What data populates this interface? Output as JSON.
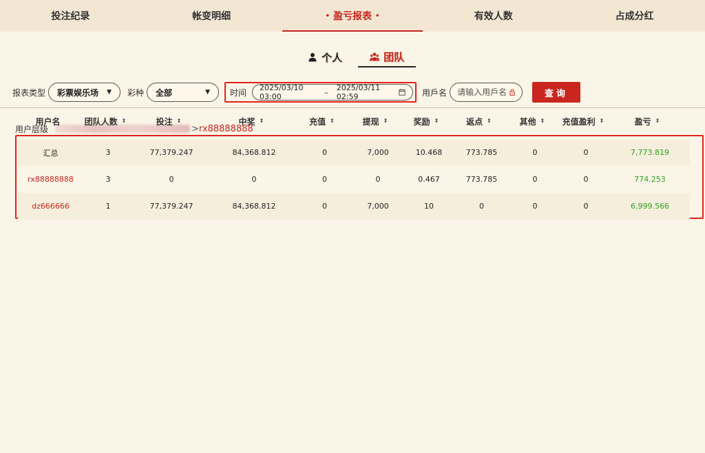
{
  "top_tabs": [
    {
      "label": "投注纪录",
      "active": false
    },
    {
      "label": "帐变明细",
      "active": false
    },
    {
      "label": "盈亏报表",
      "active": true
    },
    {
      "label": "有效人数",
      "active": false
    },
    {
      "label": "占成分红",
      "active": false
    }
  ],
  "active_tab_dots": "•",
  "sub_tabs": {
    "personal": "个人",
    "team": "团队",
    "active": "team"
  },
  "filters": {
    "report_type_label": "报表类型",
    "report_type_value": "彩票娱乐场",
    "lottery_kind_label": "彩种",
    "lottery_kind_value": "全部",
    "time_label": "时间",
    "time_start": "2025/03/10 03:00",
    "time_separator": "–",
    "time_end": "2025/03/11 02:59",
    "username_label": "用戶名",
    "username_placeholder": "请输入用戶名",
    "search_button": "查询"
  },
  "hierarchy": {
    "label": "用户层级",
    "separator": ">",
    "current": "rx88888888"
  },
  "table": {
    "headers": [
      "用户名",
      "团队人数",
      "投注",
      "中奖",
      "充值",
      "提现",
      "奖励",
      "返点",
      "其他",
      "充值盈利",
      "盈亏"
    ],
    "sort_icon": "⇕",
    "rows": [
      [
        "汇总",
        "3",
        "77,379.247",
        "84,368.812",
        "0",
        "7,000",
        "10.468",
        "773.785",
        "0",
        "0",
        "7,773.819"
      ],
      [
        "rx88888888",
        "3",
        "0",
        "0",
        "0",
        "0",
        "0.467",
        "773.785",
        "0",
        "0",
        "774.253"
      ],
      [
        "dz666666",
        "1",
        "77,379.247",
        "84,368.812",
        "0",
        "7,000",
        "10",
        "0",
        "0",
        "0",
        "6,999.566"
      ]
    ]
  },
  "colors": {
    "accent": "#c8261e",
    "highlight_border": "#e0211b",
    "profit_green": "#27a31c",
    "background": "#fbf5e7"
  },
  "icons": {
    "personal": "person-icon",
    "team": "team-icon",
    "calendar": "calendar-icon",
    "lock": "lock-icon",
    "dropdown": "chevron-down-icon"
  }
}
